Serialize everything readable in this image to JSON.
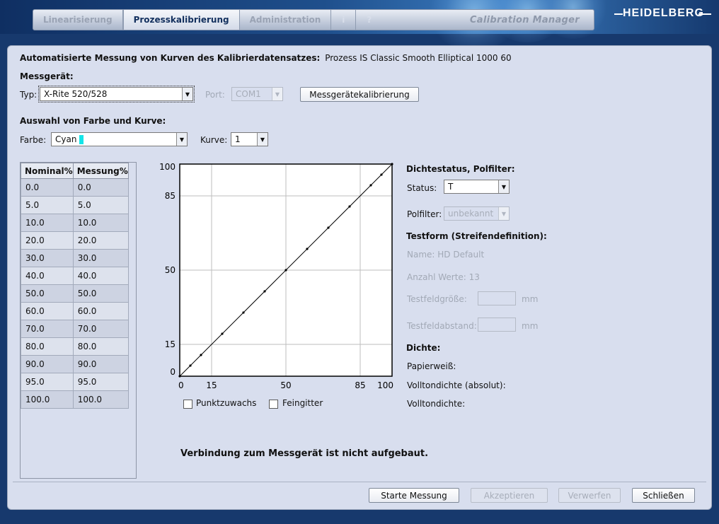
{
  "tabs": {
    "linearisierung": "Linearisierung",
    "prozesskalibrierung": "Prozesskalibrierung",
    "administration": "Administration",
    "info": "i",
    "help": "?"
  },
  "app_title": "Calibration Manager",
  "brand": "HEIDELBERG",
  "header": {
    "label": "Automatisierte Messung von Kurven des Kalibrierdatensatzes:",
    "value": "Prozess IS Classic Smooth Elliptical 1000 60"
  },
  "device": {
    "section": "Messgerät:",
    "type_label": "Typ:",
    "type_value": "X-Rite 520/528",
    "port_label": "Port:",
    "port_value": "COM1",
    "calibrate_button": "Messgerätekalibrierung"
  },
  "selection": {
    "section": "Auswahl von Farbe und Kurve:",
    "color_label": "Farbe:",
    "color_value": "Cyan",
    "color_swatch": "#14e4e8",
    "curve_label": "Kurve:",
    "curve_value": "1"
  },
  "table": {
    "headers": [
      "Nominal%",
      "Messung%"
    ],
    "rows": [
      [
        "0.0",
        "0.0"
      ],
      [
        "5.0",
        "5.0"
      ],
      [
        "10.0",
        "10.0"
      ],
      [
        "20.0",
        "20.0"
      ],
      [
        "30.0",
        "30.0"
      ],
      [
        "40.0",
        "40.0"
      ],
      [
        "50.0",
        "50.0"
      ],
      [
        "60.0",
        "60.0"
      ],
      [
        "70.0",
        "70.0"
      ],
      [
        "80.0",
        "80.0"
      ],
      [
        "90.0",
        "90.0"
      ],
      [
        "95.0",
        "95.0"
      ],
      [
        "100.0",
        "100.0"
      ]
    ]
  },
  "chart_data": {
    "type": "line",
    "x": [
      0,
      5,
      10,
      20,
      30,
      40,
      50,
      60,
      70,
      80,
      90,
      95,
      100
    ],
    "y": [
      0,
      5,
      10,
      20,
      30,
      40,
      50,
      60,
      70,
      80,
      90,
      95,
      100
    ],
    "xlim": [
      0,
      100
    ],
    "ylim": [
      0,
      100
    ],
    "x_ticks": [
      "0",
      "15",
      "50",
      "85",
      "100"
    ],
    "y_ticks": [
      "0",
      "15",
      "50",
      "85",
      "100"
    ],
    "grid": true
  },
  "options": {
    "punktzuwachs": "Punktzuwachs",
    "feingitter": "Feingitter"
  },
  "density_status": {
    "section": "Dichtestatus, Polfilter:",
    "status_label": "Status:",
    "status_value": "T",
    "polfilter_label": "Polfilter:",
    "polfilter_value": "unbekannt"
  },
  "testform": {
    "section": "Testform (Streifendefinition):",
    "name": "Name: HD Default",
    "count": "Anzahl Werte: 13",
    "size_label": "Testfeldgröße:",
    "size_unit": "mm",
    "spacing_label": "Testfeldabstand:",
    "spacing_unit": "mm"
  },
  "density": {
    "section": "Dichte:",
    "paper_white": "Papierweiß:",
    "solid_absolute": "Volltondichte (absolut):",
    "solid": "Volltondichte:"
  },
  "status_message": "Verbindung zum Messgerät ist nicht aufgebaut.",
  "buttons": {
    "start": "Starte Messung",
    "accept": "Akzeptieren",
    "discard": "Verwerfen",
    "close": "Schließen"
  }
}
